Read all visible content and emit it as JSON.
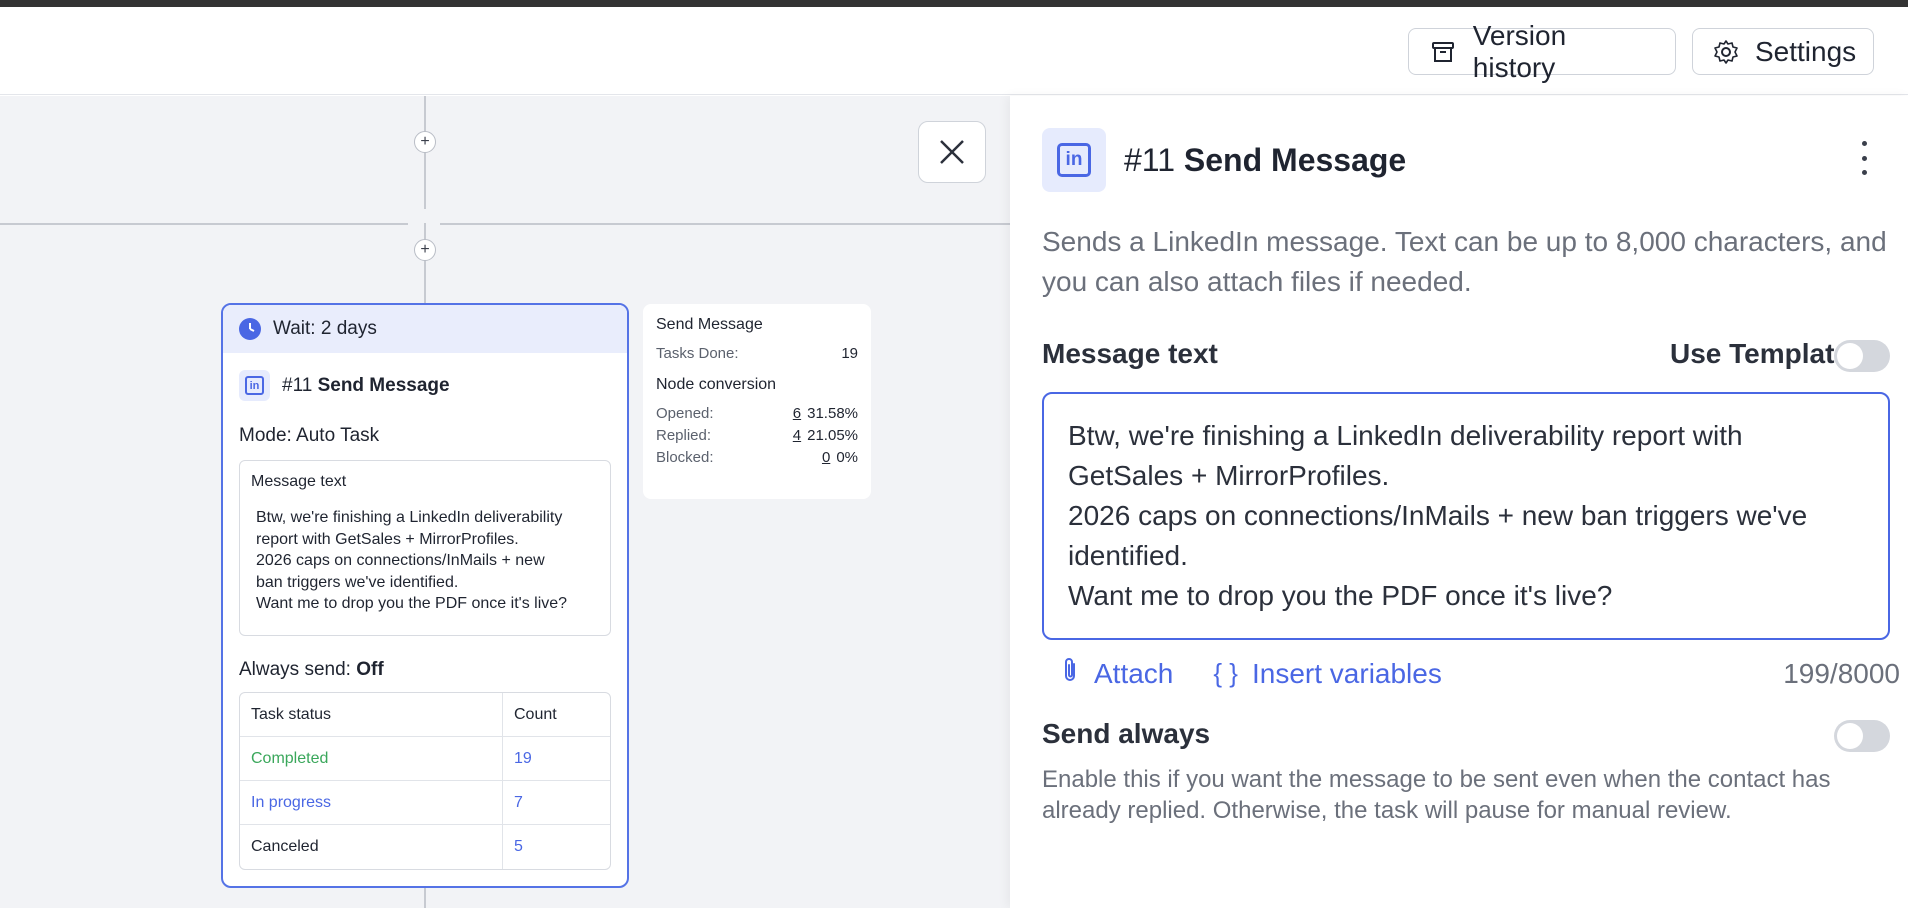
{
  "header": {
    "version_history_label": "Version history",
    "settings_label": "Settings"
  },
  "canvas": {
    "plus_symbol": "+",
    "node": {
      "wait_label": "Wait: 2 days",
      "number": "#11",
      "title": "Send Message",
      "mode_prefix": "Mode:",
      "mode_value": "Auto Task",
      "message_label": "Message text",
      "message_lines": [
        "Btw, we're finishing a LinkedIn deliverability",
        "report with GetSales + MirrorProfiles.",
        "2026 caps on connections/InMails + new",
        "ban triggers we've identified.",
        "Want me to drop you the PDF once it's live?"
      ],
      "always_send_prefix": "Always send:",
      "always_send_value": "Off",
      "table": {
        "headers": [
          "Task status",
          "Count"
        ],
        "rows": [
          {
            "status": "Completed",
            "count": "19"
          },
          {
            "status": "In progress",
            "count": "7"
          },
          {
            "status": "Canceled",
            "count": "5"
          }
        ]
      }
    },
    "stats": {
      "title": "Send Message",
      "tasks_done_label": "Tasks Done:",
      "tasks_done_value": "19",
      "conversion_title": "Node conversion",
      "rows": [
        {
          "label": "Opened:",
          "count": "6",
          "pct": "31.58%"
        },
        {
          "label": "Replied:",
          "count": "4",
          "pct": "21.05%"
        },
        {
          "label": "Blocked:",
          "count": "0",
          "pct": "0%"
        }
      ]
    }
  },
  "panel": {
    "number": "#11",
    "title": "Send Message",
    "description": "Sends a LinkedIn message. Text can be up to 8,000 characters, and you can also attach files if needed.",
    "message_label": "Message text",
    "use_template_label": "Use Template",
    "use_template_on": false,
    "message_lines": [
      "Btw, we're finishing a LinkedIn deliverability report with",
      "GetSales + MirrorProfiles.",
      "2026 caps on connections/InMails + new ban triggers we've",
      "identified.",
      "Want me to drop you the PDF once it's live?"
    ],
    "attach_label": "Attach",
    "variables_glyph": "{ }",
    "insert_variables_label": "Insert variables",
    "char_counter": "199/8000",
    "send_always_label": "Send always",
    "send_always_on": false,
    "send_always_desc_lines": [
      "Enable this if you want the message to be sent even when the contact has",
      "already replied. Otherwise, the task will pause for manual review."
    ],
    "accent_color": "#4a67e4"
  }
}
